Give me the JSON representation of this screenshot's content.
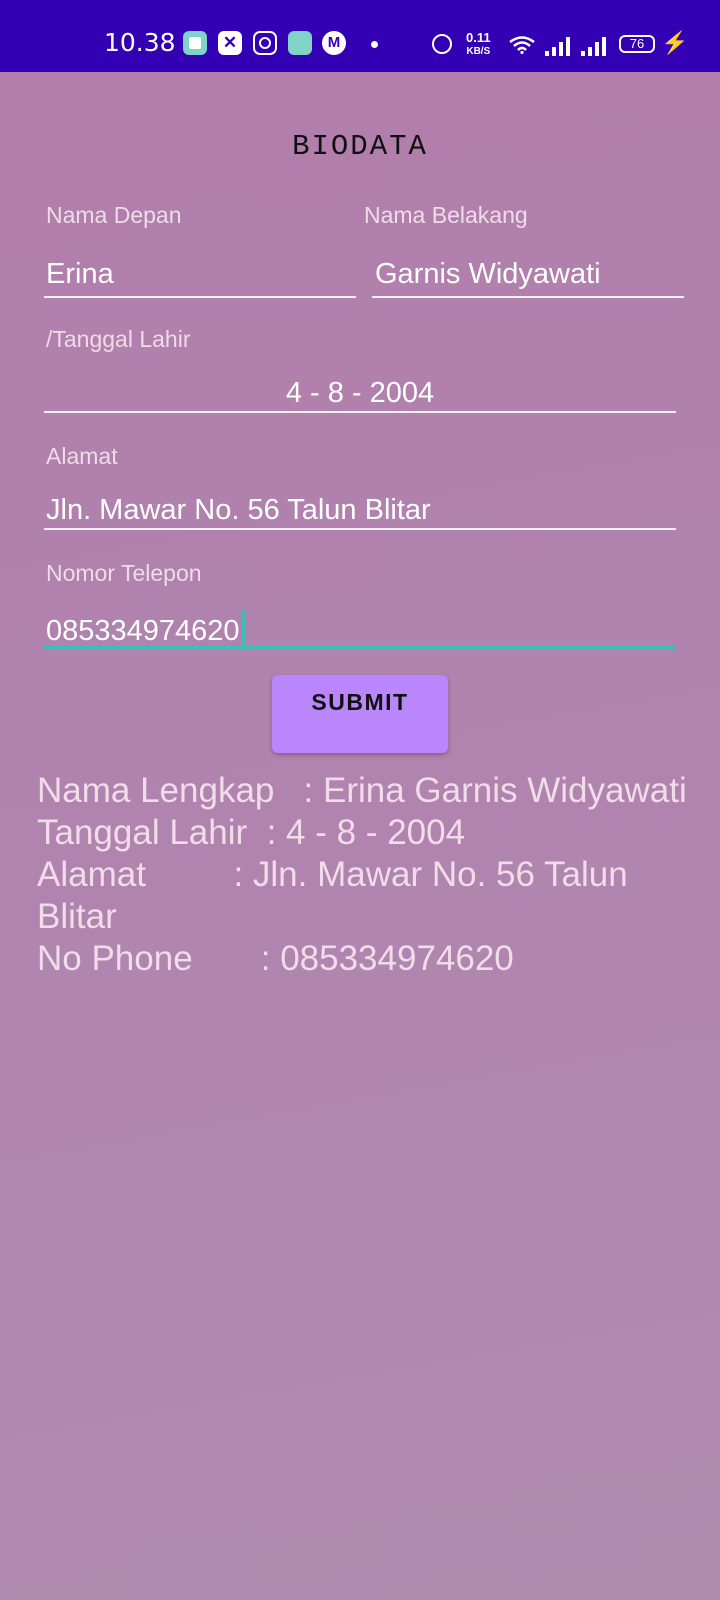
{
  "status_bar": {
    "time": "10.38",
    "net_speed_value": "0.11",
    "net_speed_unit": "KB/S",
    "battery": "76",
    "icons": [
      "app-icon",
      "capcut-icon",
      "instagram-icon",
      "app-store-icon",
      "m-icon",
      "notification-dot",
      "alarm-icon",
      "wifi-icon",
      "signal-icon",
      "signal-icon",
      "battery-icon",
      "charging-icon"
    ]
  },
  "form": {
    "title": "BIODATA",
    "first_name_label": "Nama Depan",
    "first_name_value": "Erina",
    "last_name_label": "Nama Belakang",
    "last_name_value": "Garnis Widyawati",
    "birth_label": "/Tanggal Lahir",
    "birth_value": "4 - 8 - 2004",
    "address_label": "Alamat",
    "address_value": "Jln. Mawar No. 56 Talun Blitar",
    "phone_label": "Nomor Telepon",
    "phone_value": "085334974620",
    "submit_label": "SUBMIT"
  },
  "result": {
    "line1": "Nama Lengkap   : Erina Garnis Widyawati",
    "line2": "Tanggal Lahir  : 4 - 8 - 2004",
    "line3": "Alamat         : Jln. Mawar No. 56 Talun Blitar",
    "line4": "No Phone       : 085334974620"
  },
  "colors": {
    "status_bar": "#3300b4",
    "background": "#b083ae",
    "button": "#b987fb",
    "focus_accent": "#3bbfb8"
  }
}
